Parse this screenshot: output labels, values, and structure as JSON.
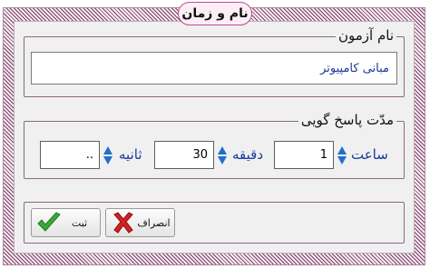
{
  "window": {
    "title": "نام و زمان"
  },
  "exam_name": {
    "label": "نام آزمون",
    "value": "مبانی کامپیوتر"
  },
  "duration": {
    "label": "مدّت پاسخ گویی",
    "hour_label": "ساعت",
    "hour_value": "1",
    "minute_label": "دقیقه",
    "minute_value": "30",
    "second_label": "ثانیه",
    "second_value": ".."
  },
  "actions": {
    "cancel_label": "انصراف",
    "cancel_icon": "red-x-icon",
    "submit_label": "ثبت",
    "submit_icon": "green-checkmark-icon"
  },
  "colors": {
    "accent_pink": "#c04a92",
    "label_blue": "#1a3a9a",
    "spinner_blue": "#1e6fd0",
    "cancel_red": "#d42020",
    "submit_green": "#3aa83a"
  }
}
